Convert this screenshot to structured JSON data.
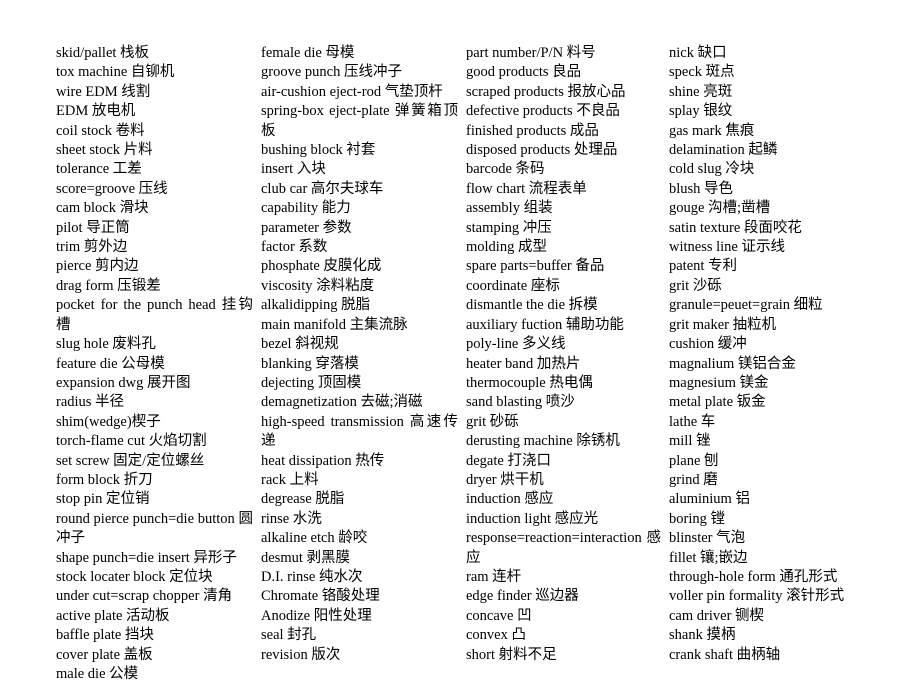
{
  "document": {
    "type": "bilingual-glossary",
    "title": "Die / Stamping & Molding Terminology Glossary (English–Chinese)",
    "columns": [
      {
        "id": "column-1",
        "entries": [
          "skid/pallet 栈板",
          "tox machine 自铆机",
          "wire EDM 线割",
          "EDM 放电机",
          "coil stock 卷料",
          "sheet stock 片料",
          "tolerance 工差",
          "score=groove 压线",
          "cam block 滑块",
          "pilot 导正筒",
          "trim 剪外边",
          "pierce 剪内边",
          "drag form 压锻差",
          "pocket for the punch head 挂钩槽",
          "slug hole 废料孔",
          "feature die 公母模",
          "expansion dwg 展开图",
          "radius 半径",
          "shim(wedge)楔子",
          "torch-flame cut 火焰切割",
          "set screw 固定/定位螺丝",
          "form block 折刀",
          "stop pin 定位销",
          "round pierce punch=die button 圆冲子",
          "shape punch=die insert 异形子",
          "stock locater block 定位块",
          "under cut=scrap chopper 清角",
          "active plate 活动板",
          "baffle plate 挡块",
          "cover plate 盖板",
          "male die 公模"
        ]
      },
      {
        "id": "column-2",
        "entries": [
          "female die 母模",
          "groove punch 压线冲子",
          "air-cushion eject-rod 气垫顶杆",
          "spring-box eject-plate 弹簧箱顶板",
          "bushing block 衬套",
          "insert 入块",
          "club car 高尔夫球车",
          "capability 能力",
          "parameter 参数",
          "factor 系数",
          "phosphate 皮膜化成",
          "viscosity 涂料粘度",
          "alkalidipping 脱脂",
          "main manifold 主集流脉",
          "bezel 斜视规",
          "blanking 穿落模",
          "dejecting 顶固模",
          "demagnetization 去磁;消磁",
          "high-speed transmission 高速传递",
          "heat dissipation 热传",
          "rack 上料",
          "degrease 脱脂",
          "rinse 水洗",
          "alkaline etch 龄咬",
          "desmut 剥黑膜",
          "D.I. rinse 纯水次",
          "Chromate 铬酸处理",
          "Anodize 阳性处理",
          "seal 封孔",
          "revision 版次"
        ]
      },
      {
        "id": "column-3",
        "entries": [
          "part number/P/N 料号",
          "good products 良品",
          "scraped products 报放心品",
          "defective products 不良品",
          "finished products 成品",
          "disposed products 处理品",
          "barcode 条码",
          "flow chart 流程表单",
          "assembly 组装",
          "stamping 冲压",
          "molding 成型",
          "spare parts=buffer 备品",
          "coordinate 座标",
          "dismantle the die 拆模",
          "auxiliary fuction 辅助功能",
          "poly-line 多义线",
          "heater band 加热片",
          "thermocouple 热电偶",
          "sand blasting 喷沙",
          "grit 砂砾",
          "derusting machine 除锈机",
          "degate 打浇口",
          "dryer 烘干机",
          "induction 感应",
          "induction light 感应光",
          "response=reaction=interaction 感应",
          "ram 连杆",
          "edge finder 巡边器",
          "concave 凹",
          "convex 凸",
          "short 射料不足"
        ]
      },
      {
        "id": "column-4",
        "entries": [
          "nick 缺口",
          "speck 斑点",
          "shine 亮斑",
          "splay 银纹",
          "gas mark 焦痕",
          "delamination 起鳞",
          "cold slug 冷块",
          "blush 导色",
          "gouge 沟槽;凿槽",
          "satin texture 段面咬花",
          "witness line 证示线",
          "patent 专利",
          "grit 沙砾",
          "granule=peuet=grain 细粒",
          "grit maker 抽粒机",
          "cushion 缓冲",
          "magnalium 镁铝合金",
          "magnesium 镁金",
          "metal plate 钣金",
          "lathe 车",
          "mill 锉",
          "plane 刨",
          "grind 磨",
          "aluminium 铝",
          "boring 镗",
          "blinster 气泡",
          "fillet 镶;嵌边",
          "through-hole form 通孔形式",
          "voller pin formality 滚针形式",
          "cam driver 铡楔",
          "shank 摸柄",
          "crank shaft 曲柄轴"
        ]
      }
    ]
  }
}
